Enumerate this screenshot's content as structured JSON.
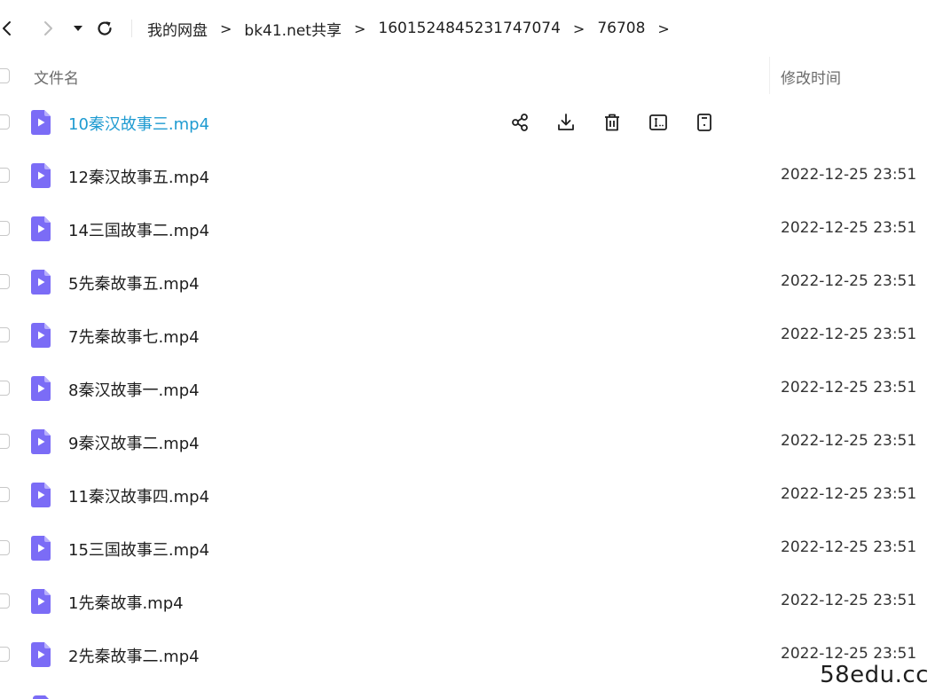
{
  "breadcrumb": [
    "我的网盘",
    "bk41.net共享",
    "1601524845231747074",
    "76708"
  ],
  "breadcrumb_separator": ">",
  "list_header": {
    "name_label": "文件名",
    "time_label": "修改时间"
  },
  "files": [
    {
      "name": "10秦汉故事三.mp4",
      "time": ""
    },
    {
      "name": "12秦汉故事五.mp4",
      "time": "2022-12-25 23:51"
    },
    {
      "name": "14三国故事二.mp4",
      "time": "2022-12-25 23:51"
    },
    {
      "name": "5先秦故事五.mp4",
      "time": "2022-12-25 23:51"
    },
    {
      "name": "7先秦故事七.mp4",
      "time": "2022-12-25 23:51"
    },
    {
      "name": "8秦汉故事一.mp4",
      "time": "2022-12-25 23:51"
    },
    {
      "name": "9秦汉故事二.mp4",
      "time": "2022-12-25 23:51"
    },
    {
      "name": "11秦汉故事四.mp4",
      "time": "2022-12-25 23:51"
    },
    {
      "name": "15三国故事三.mp4",
      "time": "2022-12-25 23:51"
    },
    {
      "name": "1先秦故事.mp4",
      "time": "2022-12-25 23:51"
    },
    {
      "name": "2先秦故事二.mp4",
      "time": "2022-12-25 23:51"
    }
  ],
  "hover_row_index": 0,
  "row_actions": [
    "share-icon",
    "download-icon",
    "delete-icon",
    "rename-icon",
    "details-icon"
  ],
  "icons": {
    "back": "chevron-left-icon",
    "forward": "chevron-right-icon",
    "history": "caret-down-icon",
    "refresh": "refresh-icon",
    "file": "video-file-icon"
  },
  "colors": {
    "hover_name": "#1f9bd1",
    "file_icon": "#7b6cf6",
    "file_icon_fold": "#b7aefc"
  },
  "watermark": "58edu.cc"
}
